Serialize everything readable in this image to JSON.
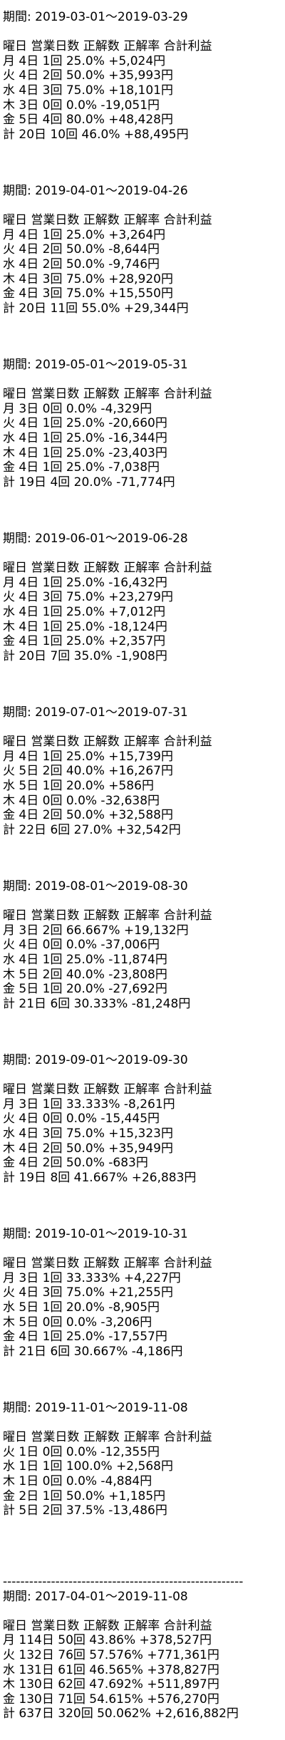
{
  "period_label": "期間: ",
  "header": "曜日 営業日数 正解数 正解率 合計利益",
  "separator": "-------------------------------------------------------",
  "periods": [
    {
      "range": "2019-03-01～2019-03-29",
      "rows": [
        "月 4日 1回 25.0% +5,024円",
        "火 4日 2回 50.0% +35,993円",
        "水 4日 3回 75.0% +18,101円",
        "木 3日 0回 0.0% -19,051円",
        "金 5日 4回 80.0% +48,428円",
        "計 20日 10回 46.0% +88,495円"
      ]
    },
    {
      "range": "2019-04-01～2019-04-26",
      "rows": [
        "月 4日 1回 25.0% +3,264円",
        "火 4日 2回 50.0% -8,644円",
        "水 4日 2回 50.0% -9,746円",
        "木 4日 3回 75.0% +28,920円",
        "金 4日 3回 75.0% +15,550円",
        "計 20日 11回 55.0% +29,344円"
      ]
    },
    {
      "range": "2019-05-01～2019-05-31",
      "rows": [
        "月 3日 0回 0.0% -4,329円",
        "火 4日 1回 25.0% -20,660円",
        "水 4日 1回 25.0% -16,344円",
        "木 4日 1回 25.0% -23,403円",
        "金 4日 1回 25.0% -7,038円",
        "計 19日 4回 20.0% -71,774円"
      ]
    },
    {
      "range": "2019-06-01～2019-06-28",
      "rows": [
        "月 4日 1回 25.0% -16,432円",
        "火 4日 3回 75.0% +23,279円",
        "水 4日 1回 25.0% +7,012円",
        "木 4日 1回 25.0% -18,124円",
        "金 4日 1回 25.0% +2,357円",
        "計 20日 7回 35.0% -1,908円"
      ]
    },
    {
      "range": "2019-07-01～2019-07-31",
      "rows": [
        "月 4日 1回 25.0% +15,739円",
        "火 5日 2回 40.0% +16,267円",
        "水 5日 1回 20.0% +586円",
        "木 4日 0回 0.0% -32,638円",
        "金 4日 2回 50.0% +32,588円",
        "計 22日 6回 27.0% +32,542円"
      ]
    },
    {
      "range": "2019-08-01～2019-08-30",
      "rows": [
        "月 3日 2回 66.667% +19,132円",
        "火 4日 0回 0.0% -37,006円",
        "水 4日 1回 25.0% -11,874円",
        "木 5日 2回 40.0% -23,808円",
        "金 5日 1回 20.0% -27,692円",
        "計 21日 6回 30.333% -81,248円"
      ]
    },
    {
      "range": "2019-09-01～2019-09-30",
      "rows": [
        "月 3日 1回 33.333% -8,261円",
        "火 4日 0回 0.0% -15,445円",
        "水 4日 3回 75.0% +15,323円",
        "木 4日 2回 50.0% +35,949円",
        "金 4日 2回 50.0% -683円",
        "計 19日 8回 41.667% +26,883円"
      ]
    },
    {
      "range": "2019-10-01～2019-10-31",
      "rows": [
        "月 3日 1回 33.333% +4,227円",
        "火 4日 3回 75.0% +21,255円",
        "水 5日 1回 20.0% -8,905円",
        "木 5日 0回 0.0% -3,206円",
        "金 4日 1回 25.0% -17,557円",
        "計 21日 6回 30.667% -4,186円"
      ]
    },
    {
      "range": "2019-11-01～2019-11-08",
      "rows": [
        "火 1日 0回 0.0% -12,355円",
        "水 1日 1回 100.0% +2,568円",
        "木 1日 0回 0.0% -4,884円",
        "金 2日 1回 50.0% +1,185円",
        "計 5日 2回 37.5% -13,486円"
      ]
    }
  ],
  "total": {
    "range": "2017-04-01～2019-11-08",
    "rows": [
      "月 114日 50回 43.86% +378,527円",
      "火 132日 76回 57.576% +771,361円",
      "水 131日 61回 46.565% +378,827円",
      "木 130日 62回 47.692% +511,897円",
      "金 130日 71回 54.615% +576,270円",
      "計 637日 320回 50.062% +2,616,882円"
    ]
  }
}
